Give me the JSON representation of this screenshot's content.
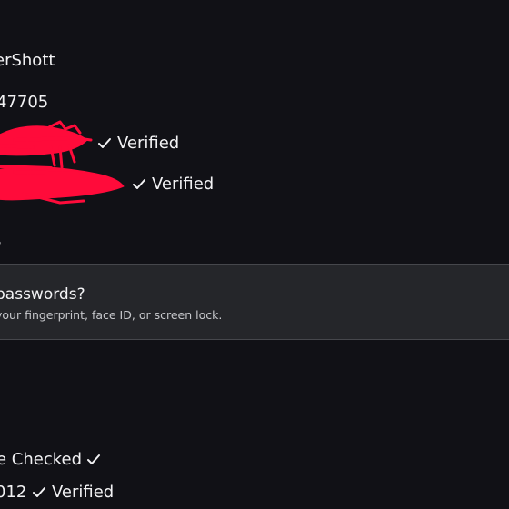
{
  "account": {
    "username_partial": "erShott",
    "id_partial": "47705",
    "email_verified_label": "Verified",
    "phone_verified_label": "Verified",
    "section_fragment": "s"
  },
  "passkey_card": {
    "title_partial": "passwords?",
    "subtitle_partial": "your fingerprint, face ID, or screen lock."
  },
  "bottom": {
    "checked_partial": "e Checked",
    "code_partial": "012",
    "code_verified_label": "Verified"
  },
  "colors": {
    "background": "#111116",
    "card_background": "#25262a",
    "redaction": "#ff0b3a"
  }
}
